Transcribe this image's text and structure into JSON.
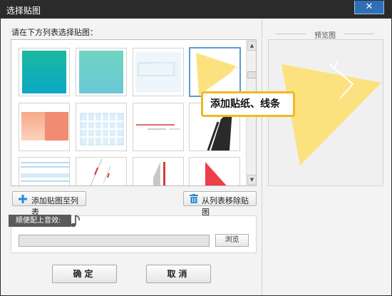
{
  "window": {
    "title": "选择贴图",
    "close_glyph": "✕"
  },
  "list": {
    "label": "请在下方列表选择贴图：",
    "thumbnails": [
      {
        "name": "teal-gradient",
        "selected": false
      },
      {
        "name": "mint-gradient",
        "selected": false
      },
      {
        "name": "light-frame",
        "selected": false
      },
      {
        "name": "yellow-triangle",
        "selected": true
      },
      {
        "name": "salmon-gradient",
        "selected": false
      },
      {
        "name": "blue-grid",
        "selected": false
      },
      {
        "name": "red-line",
        "selected": false
      },
      {
        "name": "black-stroke",
        "selected": false
      },
      {
        "name": "blue-lines",
        "selected": false
      },
      {
        "name": "red-dashes",
        "selected": false
      },
      {
        "name": "grey-bars",
        "selected": false
      },
      {
        "name": "red-triangle",
        "selected": false
      }
    ],
    "scroll_up_glyph": "▲",
    "scroll_down_glyph": "▼"
  },
  "tooltip": {
    "text": "添加贴纸、线条"
  },
  "buttons": {
    "add_label": "添加贴图至列表",
    "remove_label": "从列表移除贴图",
    "ok_label": "确定",
    "cancel_label": "取消"
  },
  "sound": {
    "tab_label": "顺便配上音效:",
    "file_value": "",
    "browse_label": "浏览"
  },
  "preview": {
    "title": "预览图"
  },
  "colors": {
    "title_bar": "#2b2b2b",
    "close_button": "#2f6fb8",
    "tooltip_border": "#f2b81f",
    "triangle_yellow": "#fbe27f",
    "accent_blue": "#2a8ad4"
  },
  "icons": {
    "add": "plus-icon",
    "remove": "trash-icon",
    "sound": "music-note-icon",
    "close": "close-icon"
  }
}
